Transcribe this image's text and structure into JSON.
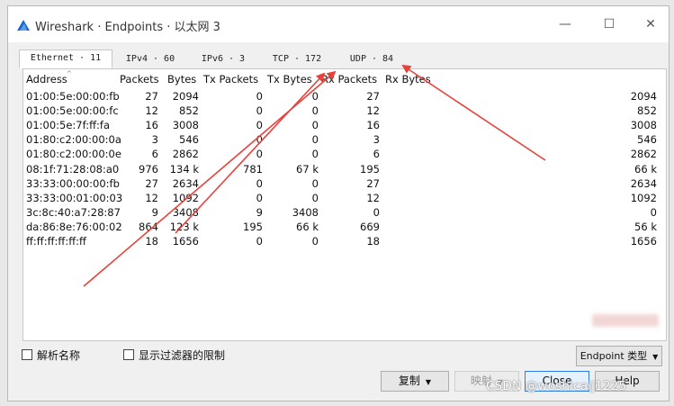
{
  "window": {
    "title": "Wireshark · Endpoints · 以太网 3",
    "minimize_glyph": "—",
    "maximize_glyph": "☐",
    "close_glyph": "✕"
  },
  "tabs": [
    {
      "label": "Ethernet · 11",
      "active": true
    },
    {
      "label": "IPv4 · 60",
      "active": false
    },
    {
      "label": "IPv6 · 3",
      "active": false
    },
    {
      "label": "TCP · 172",
      "active": false
    },
    {
      "label": "UDP · 84",
      "active": false
    }
  ],
  "table": {
    "columns": [
      "Address",
      "Packets",
      "Bytes",
      "Tx Packets",
      "Tx Bytes",
      "Rx Packets",
      "Rx Bytes"
    ],
    "rows": [
      [
        "01:00:5e:00:00:fb",
        "27",
        "2094",
        "0",
        "0",
        "27",
        "2094"
      ],
      [
        "01:00:5e:00:00:fc",
        "12",
        "852",
        "0",
        "0",
        "12",
        "852"
      ],
      [
        "01:00:5e:7f:ff:fa",
        "16",
        "3008",
        "0",
        "0",
        "16",
        "3008"
      ],
      [
        "01:80:c2:00:00:0a",
        "3",
        "546",
        "0",
        "0",
        "3",
        "546"
      ],
      [
        "01:80:c2:00:00:0e",
        "6",
        "2862",
        "0",
        "0",
        "6",
        "2862"
      ],
      [
        "08:1f:71:28:08:a0",
        "976",
        "134 k",
        "781",
        "67 k",
        "195",
        "66 k"
      ],
      [
        "33:33:00:00:00:fb",
        "27",
        "2634",
        "0",
        "0",
        "27",
        "2634"
      ],
      [
        "33:33:00:01:00:03",
        "12",
        "1092",
        "0",
        "0",
        "12",
        "1092"
      ],
      [
        "3c:8c:40:a7:28:87",
        "9",
        "3408",
        "9",
        "3408",
        "0",
        "0"
      ],
      [
        "da:86:8e:76:00:02",
        "864",
        "123 k",
        "195",
        "66 k",
        "669",
        "56 k"
      ],
      [
        "ff:ff:ff:ff:ff:ff",
        "18",
        "1656",
        "0",
        "0",
        "18",
        "1656"
      ]
    ]
  },
  "options": {
    "resolve_names_label": "解析名称",
    "limit_filter_label": "显示过滤器的限制",
    "endpoint_type_label": "Endpoint 类型"
  },
  "buttons": {
    "copy_label": "复制",
    "map_label": "映射",
    "close_label": "Close",
    "help_label": "Help"
  },
  "watermark": "CSDN @woshicaij1225",
  "colors": {
    "annotation_arrow": "#e8413a",
    "focus_border": "#2b7be0"
  }
}
